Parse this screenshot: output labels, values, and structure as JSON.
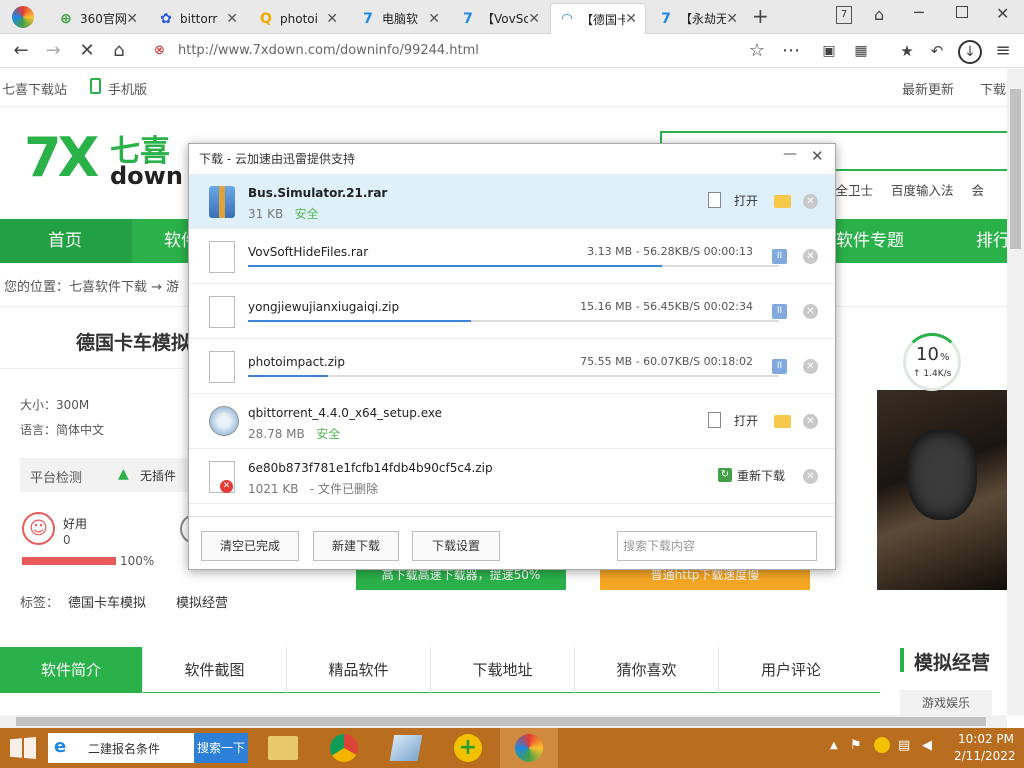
{
  "browser": {
    "tabs": [
      {
        "title": "360官网",
        "icon": "360-icon",
        "active": false
      },
      {
        "title": "bittorr",
        "icon": "baidu-paw-icon",
        "active": false
      },
      {
        "title": "photoi",
        "icon": "search-q-icon",
        "active": false
      },
      {
        "title": "电脑软",
        "icon": "site-7-icon",
        "active": false
      },
      {
        "title": "【VovSo",
        "icon": "site-7-icon",
        "active": false
      },
      {
        "title": "【德国卡",
        "icon": "loading-icon",
        "active": true
      },
      {
        "title": "【永劫无",
        "icon": "site-7-icon",
        "active": false
      }
    ],
    "url": "http://www.7xdown.com/downinfo/99244.html"
  },
  "site": {
    "site_name": "七喜下载站",
    "mobile": "手机版",
    "top_right": [
      "最新更新",
      "下载"
    ],
    "logo_text": "七喜",
    "logo_sub": "down",
    "hot_links": [
      "0安全卫士",
      "百度输入法",
      "会"
    ],
    "nav": [
      "首页",
      "软件",
      "软件专题",
      "排行"
    ],
    "breadcrumb": "您的位置：七喜软件下载 → 游",
    "page_title": "德国卡车模拟",
    "size_label": "大小：300M",
    "lang_label": "语言：简体中文",
    "platform_label": "平台检测",
    "plugin_label": "无插件",
    "like_label": "好用",
    "like_count": "0",
    "like_percent": "100%",
    "tags_label": "标签：",
    "tags": [
      "德国卡车模拟",
      "模拟经营"
    ],
    "dl_btn1": "高下载高速下载器，提速50%",
    "dl_btn2": "普通http下载速度慢",
    "tabs2": [
      "软件简介",
      "软件截图",
      "精品软件",
      "下载地址",
      "猜你喜欢",
      "用户评论"
    ],
    "side_title": "模拟经营",
    "side_item": "游戏娱乐",
    "speed_pct": "10",
    "speed_pct_unit": "%",
    "speed_rate": "↑ 1.4K/s"
  },
  "download_dialog": {
    "title": "下载 - 云加速由迅雷提供支持",
    "items": [
      {
        "name": "Bus.Simulator.21.rar",
        "size": "31 KB",
        "status": "安全",
        "state": "done",
        "action": "打开"
      },
      {
        "name": "VovSoftHideFiles.rar",
        "stats": "3.13 MB - 56.28KB/S  00:00:13",
        "progress": 0.78,
        "state": "downloading"
      },
      {
        "name": "yongjiewujianxiugaiqi.zip",
        "stats": "15.16 MB - 56.45KB/S  00:02:34",
        "progress": 0.42,
        "state": "downloading"
      },
      {
        "name": "photoimpact.zip",
        "stats": "75.55 MB - 60.07KB/S  00:18:02",
        "progress": 0.15,
        "state": "downloading"
      },
      {
        "name": "qbittorrent_4.4.0_x64_setup.exe",
        "size": "28.78 MB",
        "status": "安全",
        "state": "done",
        "action": "打开"
      },
      {
        "name": "6e80b873f781e1fcfb14fdb4b90cf5c4.zip",
        "size": "1021 KB",
        "status": "- 文件已删除",
        "state": "deleted",
        "action": "重新下载"
      }
    ],
    "buttons": {
      "clear": "清空已完成",
      "new": "新建下载",
      "settings": "下载设置"
    },
    "search_placeholder": "搜索下载内容"
  },
  "taskbar": {
    "search_text": "二建报名条件",
    "search_button": "搜索一下",
    "time": "10:02 PM",
    "date": "2/11/2022"
  },
  "colors": {
    "green": "#2bb14a",
    "taskbar": "#b96d1f",
    "progress": "#3d87d8"
  }
}
